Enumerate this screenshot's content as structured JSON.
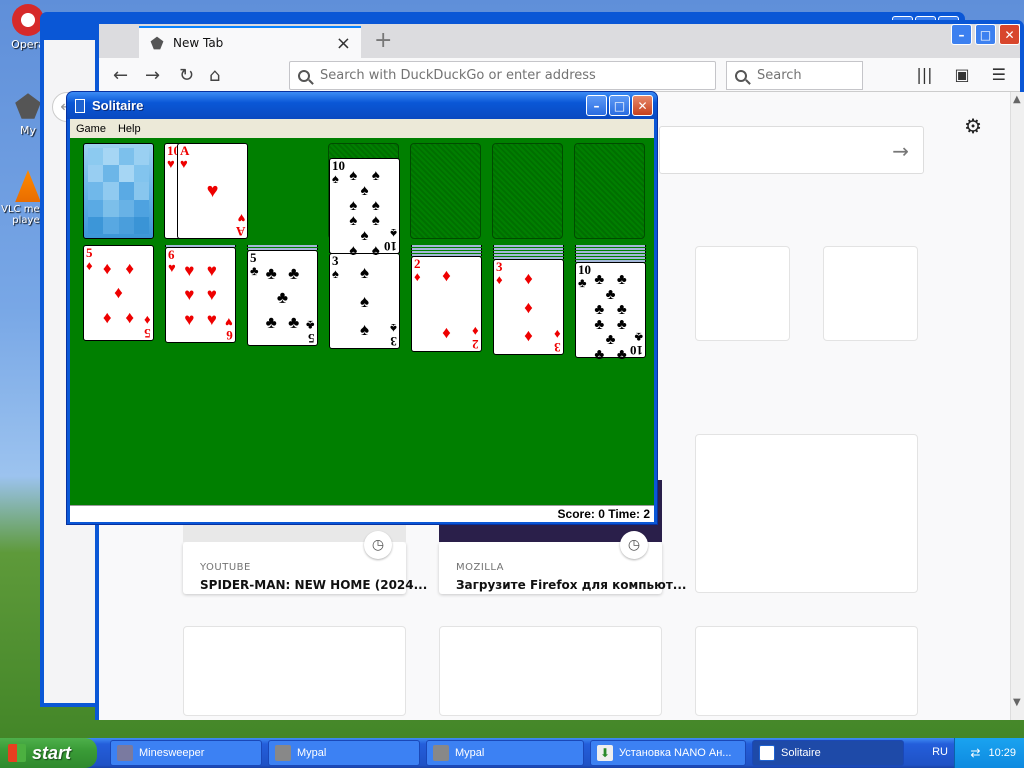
{
  "desktop": {
    "icons": [
      {
        "label": "Opera",
        "icon": "opera-icon"
      },
      {
        "label": "My",
        "icon": "mypal-icon"
      },
      {
        "label": "VLC media player",
        "icon": "vlc-icon"
      }
    ]
  },
  "browser": {
    "tab_title": "New Tab",
    "new_tab_symbol": "+",
    "address_placeholder": "Search with DuckDuckGo or enter address",
    "search_placeholder": "Search",
    "highlights": [
      {
        "source": "YOUTUBE",
        "title": "SPIDER-MAN: NEW HOME (2024..."
      },
      {
        "source": "MOZILLA",
        "title": "Загрузите Firefox для компьют..."
      }
    ]
  },
  "solitaire": {
    "title": "Solitaire",
    "menu": [
      "Game",
      "Help"
    ],
    "status": "Score: 0 Time: 2",
    "colors": {
      "felt": "#007f00",
      "red_suit": "#e00000"
    }
  },
  "taskbar": {
    "start_label": "start",
    "items": [
      {
        "label": "Minesweeper"
      },
      {
        "label": "Mypal"
      },
      {
        "label": "Mypal"
      },
      {
        "label": "Установка NANO Ан..."
      },
      {
        "label": "Solitaire"
      }
    ],
    "language": "RU",
    "clock": "10:29"
  }
}
